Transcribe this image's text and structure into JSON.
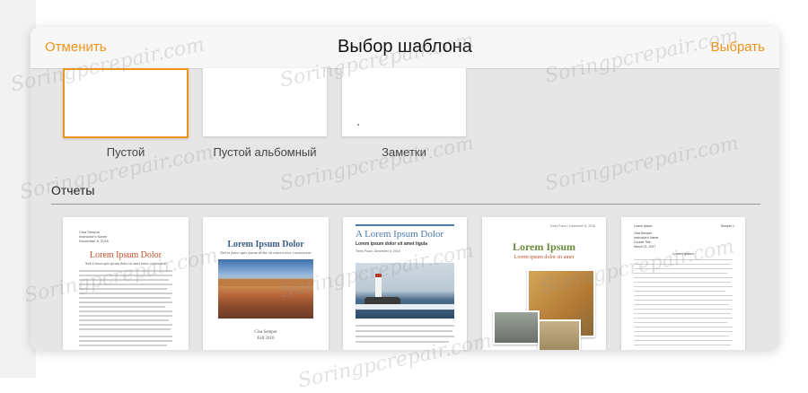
{
  "nav": {
    "cancel": "Отменить",
    "title": "Выбор шаблона",
    "choose": "Выбрать"
  },
  "templates_top": [
    {
      "label": "Пустой",
      "selected": true
    },
    {
      "label": "Пустой альбомный",
      "selected": false
    },
    {
      "label": "Заметки",
      "selected": false
    }
  ],
  "section_reports": "Отчеты",
  "reports": {
    "t1": {
      "author": "Cisa Sempre",
      "sub": "Instructor's Name",
      "date": "December 8, 2016",
      "title": "Lorem Ipsum Dolor",
      "subtitle": "Sed et fusce quis ipsum dolor sit amet tortor consectetur"
    },
    "t2": {
      "title": "Lorem Ipsum Dolor",
      "subtitle": "Sed et fusce quis ipsum dolor sit amet tortor consectetur",
      "author": "Cisa Semper",
      "date": "Fall 2016"
    },
    "t3": {
      "title": "A Lorem Ipsum Dolor",
      "subtitle": "Lorem ipsum dolor sit amet ligula",
      "meta": "Trees Pourz, December 8, 2016"
    },
    "t4": {
      "meta": "Trees Pourz / December 8, 2016",
      "title": "Lorem Ipsum",
      "subtitle": "Lorem ipsum dolor sit amet"
    },
    "t5": {
      "header_left": "Lorem Ipsum",
      "header_right": "Semper 1",
      "name": "Cisa Semper",
      "instructor": "Instructor's Name",
      "course": "Course Title",
      "date": "March 21, 2017",
      "title": "Lorem Ipsum"
    }
  },
  "watermark": "Soringpcrepair.com",
  "colors": {
    "accent": "#f0931a",
    "report_title_t1": "#c8502a",
    "report_title_t2": "#3a5c85",
    "report_title_t3": "#4a7aa8",
    "report_title_t4": "#6a8a3a",
    "report_sub_t4": "#c0502a"
  }
}
